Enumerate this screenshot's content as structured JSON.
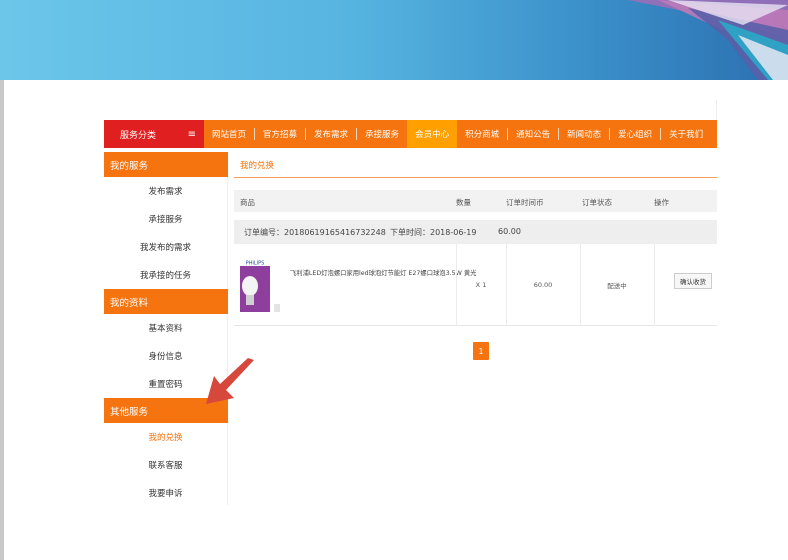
{
  "nav": {
    "category_label": "服务分类",
    "category_icon": "menu-icon",
    "items": [
      {
        "label": "网站首页"
      },
      {
        "label": "官方招募"
      },
      {
        "label": "发布需求"
      },
      {
        "label": "承接服务"
      },
      {
        "label": "会员中心",
        "active": true
      },
      {
        "label": "积分商城"
      },
      {
        "label": "通知公告"
      },
      {
        "label": "新闻动态"
      },
      {
        "label": "爱心组织"
      },
      {
        "label": "关于我们"
      }
    ]
  },
  "sidebar": {
    "sections": [
      {
        "title": "我的服务",
        "items": [
          "发布需求",
          "承接服务",
          "我发布的需求",
          "我承接的任务"
        ]
      },
      {
        "title": "我的资料",
        "items": [
          "基本资料",
          "身份信息",
          "重置密码"
        ]
      },
      {
        "title": "其他服务",
        "items": [
          "我的兑换",
          "联系客服",
          "我要申诉"
        ]
      }
    ],
    "active_item": "我的兑换"
  },
  "main": {
    "title": "我的兑换",
    "columns": [
      "商品",
      "数量",
      "订单时间币",
      "订单状态",
      "操作"
    ],
    "order": {
      "number_label": "订单编号：20180619165416732248",
      "time_label": "下单时间：2018-06-19",
      "amount": "60.00",
      "product_brand": "PHILIPS",
      "product_name": "飞利浦LED灯泡螺口家用led球泡灯节能灯 E27螺口球泡3.5W 黄光",
      "quantity": "X 1",
      "coins": "60.00",
      "status": "配送中",
      "action_label": "确认收货"
    },
    "pagination": {
      "current": "1"
    }
  },
  "colors": {
    "accent": "#f57410",
    "category": "#e02020",
    "active_nav": "#ffa000",
    "arrow": "#d7483c"
  }
}
